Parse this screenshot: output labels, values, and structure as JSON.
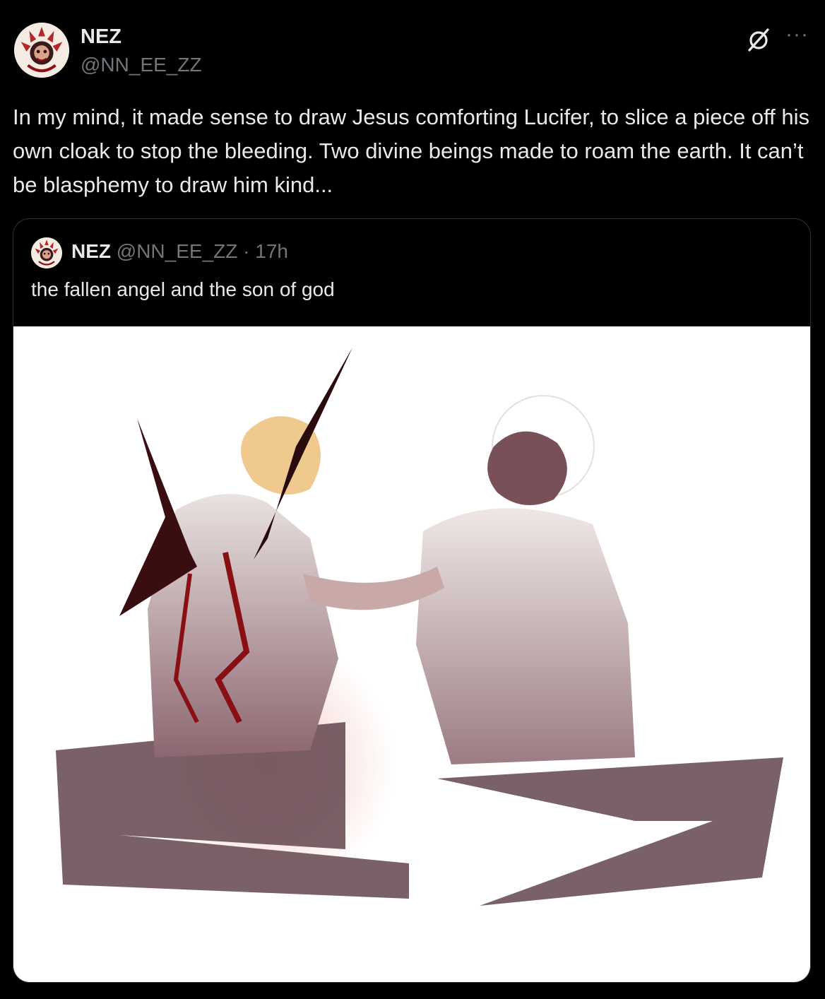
{
  "post": {
    "author_name": "NEZ",
    "author_handle": "@NN_EE_ZZ",
    "avatar_icon": "ornate-red-skull-avatar",
    "grok_icon": "grok-slash-circle-icon",
    "more_icon": "more-horizontal-icon",
    "more_glyph": "···",
    "text": "In my mind, it made sense to draw Jesus comforting Lucifer, to slice a piece off his own cloak to stop the bleeding. Two divine beings made to roam the earth. It can’t be blasphemy to draw him kind..."
  },
  "quoted_post": {
    "author_name": "NEZ",
    "author_handle": "@NN_EE_ZZ",
    "separator": "·",
    "time": "17h",
    "text": "the fallen angel and the son of god",
    "image_subject": "illustration of two seated figures seen from behind, one with torn bloody wings, the other with a halo resting his arm on the first's shoulder"
  },
  "colors": {
    "background": "#000000",
    "text_primary": "#e7e9ea",
    "text_secondary": "#71767b",
    "border": "#2f3336",
    "blood_red": "#8a0f14",
    "cloak_mauve": "#7a5a60",
    "shadow_pink": "#f3b9b6"
  }
}
